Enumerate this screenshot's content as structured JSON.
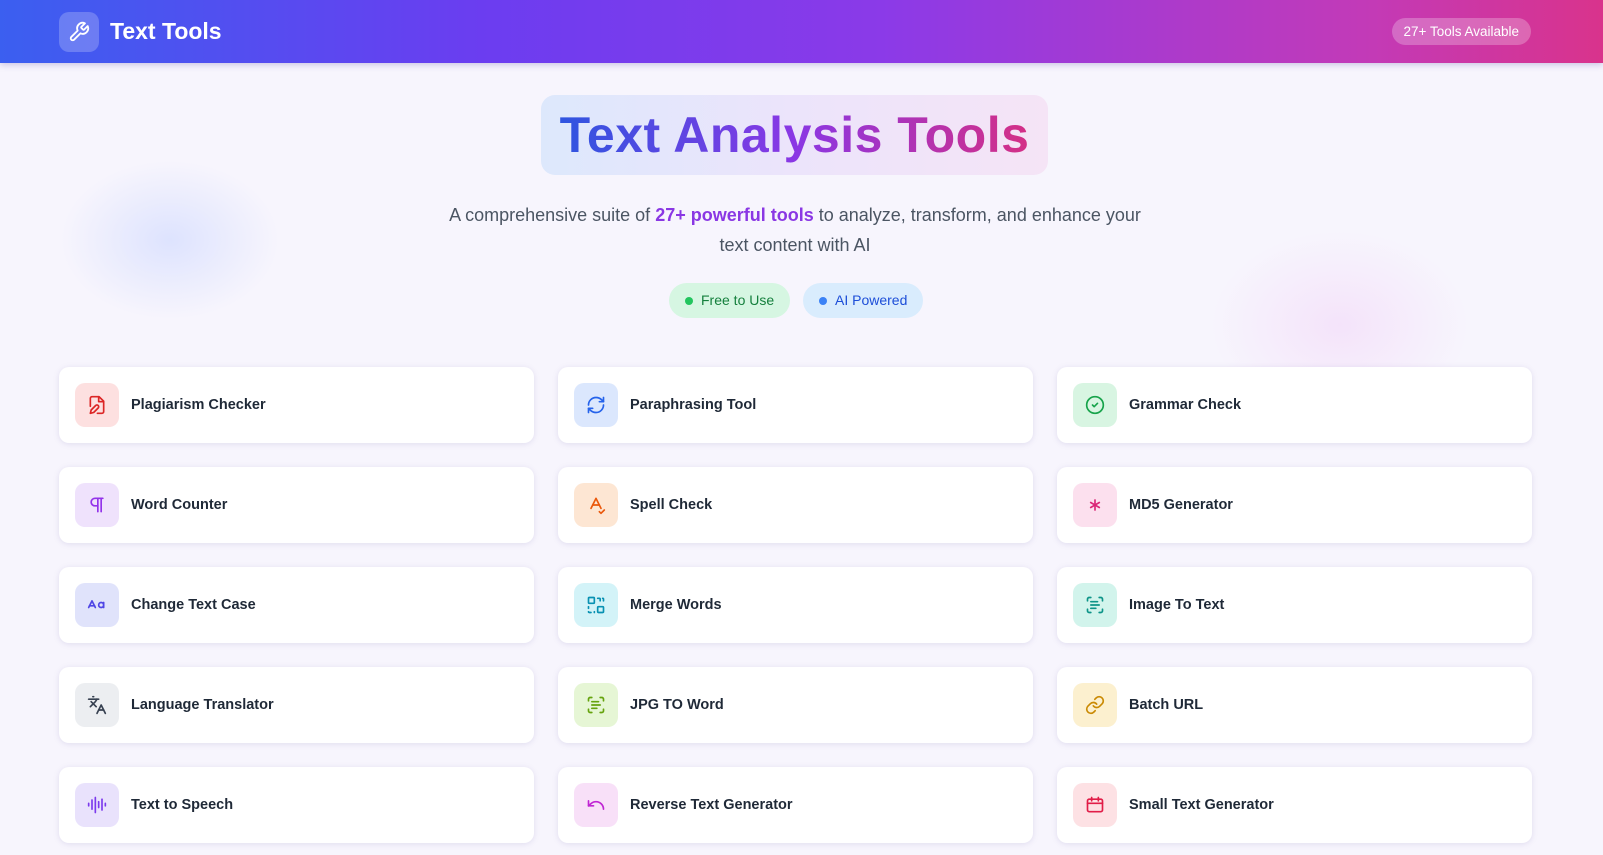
{
  "header": {
    "title": "Text Tools",
    "logo_icon": "wrench-icon",
    "tools_badge": "27+ Tools Available"
  },
  "hero": {
    "title": "Text Analysis Tools",
    "subtitle_prefix": "A comprehensive suite of ",
    "subtitle_highlight": "27+ powerful tools",
    "subtitle_suffix": " to analyze, transform, and enhance your text content with AI",
    "badges": [
      {
        "label": "Free to Use",
        "color": "#22c55e"
      },
      {
        "label": "AI Powered",
        "color": "#3b82f6"
      }
    ]
  },
  "tools": [
    {
      "label": "Plagiarism Checker",
      "icon": "file-edit-icon",
      "icon_color": "#dc2626",
      "bg": "#fde0e0"
    },
    {
      "label": "Paraphrasing Tool",
      "icon": "refresh-icon",
      "icon_color": "#2563eb",
      "bg": "#dbe7fd"
    },
    {
      "label": "Grammar Check",
      "icon": "check-circle-icon",
      "icon_color": "#16a34a",
      "bg": "#d8f5e2"
    },
    {
      "label": "Word Counter",
      "icon": "pilcrow-icon",
      "icon_color": "#9333ea",
      "bg": "#efe2fc"
    },
    {
      "label": "Spell Check",
      "icon": "spell-check-icon",
      "icon_color": "#ea580c",
      "bg": "#fde6d3"
    },
    {
      "label": "MD5 Generator",
      "icon": "asterisk-icon",
      "icon_color": "#db2777",
      "bg": "#fce0ee"
    },
    {
      "label": "Change Text Case",
      "icon": "text-case-icon",
      "icon_color": "#4f46e5",
      "bg": "#e0e3fb"
    },
    {
      "label": "Merge Words",
      "icon": "merge-grid-icon",
      "icon_color": "#0891b2",
      "bg": "#d3f3f8"
    },
    {
      "label": "Image To Text",
      "icon": "scan-text-icon",
      "icon_color": "#0d9488",
      "bg": "#d2f4ec"
    },
    {
      "label": "Language Translator",
      "icon": "translate-icon",
      "icon_color": "#374151",
      "bg": "#eceef1"
    },
    {
      "label": "JPG TO Word",
      "icon": "scan-text-icon",
      "icon_color": "#65a30d",
      "bg": "#e6f6d5"
    },
    {
      "label": "Batch URL",
      "icon": "link-icon",
      "icon_color": "#ca8a04",
      "bg": "#fcf0cf"
    },
    {
      "label": "Text to Speech",
      "icon": "audio-lines-icon",
      "icon_color": "#7c3aed",
      "bg": "#e9e2fc"
    },
    {
      "label": "Reverse Text Generator",
      "icon": "undo-icon",
      "icon_color": "#c026d3",
      "bg": "#f8e0f8"
    },
    {
      "label": "Small Text Generator",
      "icon": "calendar-icon",
      "icon_color": "#e11d48",
      "bg": "#fde1e4"
    }
  ]
}
